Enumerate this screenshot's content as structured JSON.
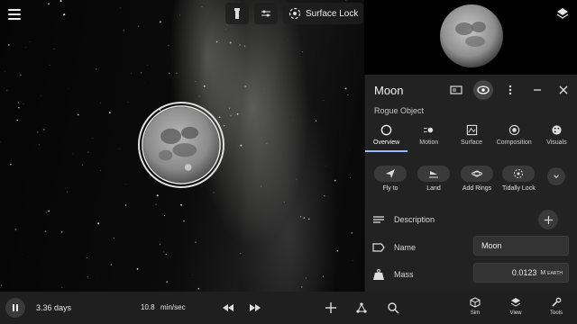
{
  "toolbar": {
    "surface_lock_label": "Surface Lock",
    "icons": [
      "flashlight-icon",
      "sliders-icon",
      "surface-lock-icon"
    ]
  },
  "panel": {
    "title": "Moon",
    "subtitle": "Rogue Object",
    "tabs": [
      {
        "label": "Overview",
        "icon": "overview-icon",
        "active": true
      },
      {
        "label": "Motion",
        "icon": "motion-icon"
      },
      {
        "label": "Surface",
        "icon": "surface-icon"
      },
      {
        "label": "Composition",
        "icon": "composition-icon"
      },
      {
        "label": "Visuals",
        "icon": "visuals-icon"
      }
    ],
    "actions": [
      {
        "label": "Fly to",
        "icon": "fly-to-icon"
      },
      {
        "label": "Land",
        "icon": "land-icon"
      },
      {
        "label": "Add Rings",
        "icon": "add-rings-icon"
      },
      {
        "label": "Tidally Lock",
        "icon": "tidally-lock-icon"
      }
    ],
    "description_label": "Description",
    "name_label": "Name",
    "name_value": "Moon",
    "mass_label": "Mass",
    "mass_value": "0.0123",
    "mass_unit": "M",
    "mass_unit_sub": "EARTH"
  },
  "bottom": {
    "elapsed": "3.36 days",
    "rate_value": "10.8",
    "rate_unit": "min/sec",
    "sim_label": "Sim",
    "view_label": "View",
    "tools_label": "Tools"
  },
  "colors": {
    "panel_bg": "#222222",
    "tab_active_underline": "#9fb5ff",
    "button_bg": "#3a3a3a"
  }
}
